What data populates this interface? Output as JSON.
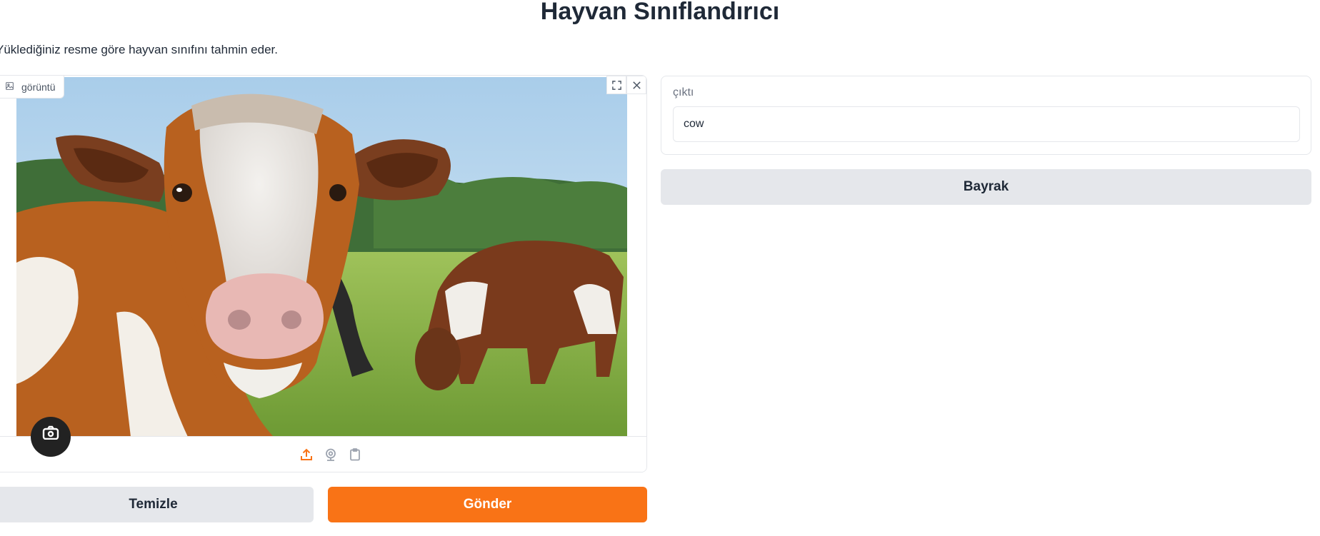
{
  "app": {
    "title": "Hayvan Sınıflandırıcı",
    "description": "Yüklediğiniz resme göre hayvan sınıfını tahmin eder."
  },
  "image_input": {
    "label": "görüntü",
    "icons": [
      "image-icon",
      "fullscreen-icon",
      "close-icon",
      "upload-icon",
      "webcam-icon",
      "clipboard-icon",
      "camera-icon"
    ]
  },
  "output": {
    "label": "çıktı",
    "value": "cow"
  },
  "buttons": {
    "flag": "Bayrak",
    "clear": "Temizle",
    "submit": "Gönder"
  },
  "colors": {
    "accent": "#f97316",
    "secondary_button": "#e5e7eb",
    "border": "#e5e7eb"
  }
}
